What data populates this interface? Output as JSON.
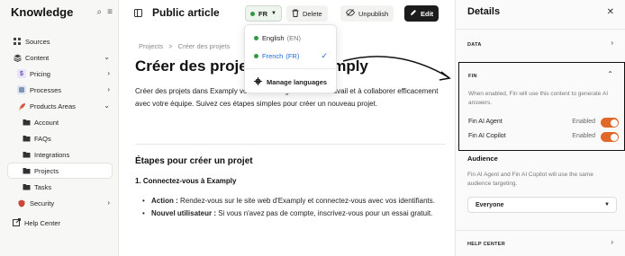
{
  "sidebar": {
    "brand": "Knowledge",
    "items": [
      {
        "label": "Sources",
        "icon": "grid-icon",
        "level": 1
      },
      {
        "label": "Content",
        "icon": "stack-icon",
        "level": 1
      },
      {
        "label": "Pricing",
        "icon": "dollar-icon",
        "level": 2
      },
      {
        "label": "Processes",
        "icon": "processes-icon",
        "level": 2
      },
      {
        "label": "Products Areas",
        "icon": "rocket-icon",
        "level": 2
      },
      {
        "label": "Account",
        "icon": "folder-icon",
        "level": 3
      },
      {
        "label": "FAQs",
        "icon": "folder-icon",
        "level": 3
      },
      {
        "label": "Integrations",
        "icon": "folder-icon",
        "level": 3
      },
      {
        "label": "Projects",
        "icon": "folder-icon",
        "level": 3
      },
      {
        "label": "Tasks",
        "icon": "folder-icon",
        "level": 3
      },
      {
        "label": "Security",
        "icon": "shield-icon",
        "level": 2
      }
    ],
    "help": "Help Center"
  },
  "topbar": {
    "title": "Public article",
    "language": "FR",
    "delete_label": "Delete",
    "unpublish_label": "Unpublish",
    "edit_label": "Edit"
  },
  "language_menu": {
    "english": "English",
    "english_code": "(EN)",
    "french": "French",
    "french_code": "(FR)",
    "manage": "Manage languages"
  },
  "article": {
    "breadcrumb_parent": "Projects",
    "breadcrumb_sep": ">",
    "breadcrumb_current": "Créer des projets",
    "heading": "Créer des projets dans Examply",
    "intro": "Créer des projets dans Examply vous aide à organiser votre travail et à collaborer efficacement avec votre équipe. Suivez ces étapes simples pour créer un nouveau projet.",
    "steps_heading": "Étapes pour créer un projet",
    "step1": "1. Connectez-vous à Examply",
    "bullet1_label": "Action :",
    "bullet1_text": " Rendez-vous sur le site web d'Examply et connectez-vous avec vos identifiants.",
    "bullet2_label": "Nouvel utilisateur :",
    "bullet2_text": " Si vous n'avez pas de compte, inscrivez-vous pour un essai gratuit."
  },
  "details": {
    "title": "Details",
    "data_label": "DATA",
    "fin_label": "FIN",
    "fin_desc": "When enabled, Fin will use this content to generate AI answers.",
    "fin_agent_label": "Fin AI Agent",
    "fin_agent_state": "Enabled",
    "fin_copilot_label": "Fin AI Copilot",
    "fin_copilot_state": "Enabled",
    "audience_title": "Audience",
    "audience_desc": "Fin AI Agent and Fin AI Copilot will use the same audience targeting.",
    "audience_value": "Everyone",
    "help_center_label": "HELP CENTER"
  },
  "colors": {
    "toggle_on": "#e0692a",
    "selected_lang": "#1f6bd6",
    "published_dot": "#2f9a3f"
  }
}
